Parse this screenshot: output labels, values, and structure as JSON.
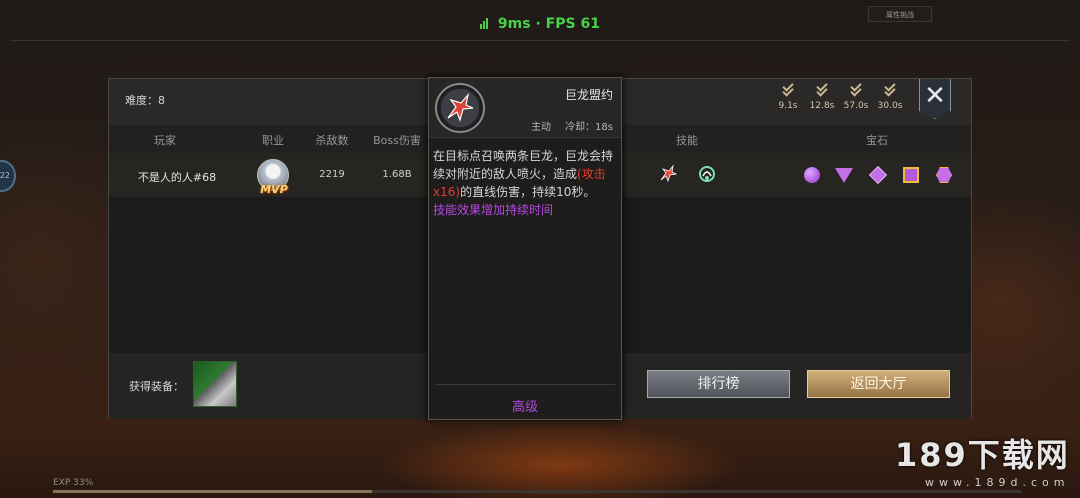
{
  "hud": {
    "ping": "9ms",
    "separator": "·",
    "fps": "FPS 61",
    "top_right_tab": "属性挑战",
    "side_badge": "22",
    "exp": "EXP 33%",
    "exp_progress": 0.33
  },
  "watermark": {
    "main": "189下载网",
    "url": "www.189d.com"
  },
  "panel": {
    "difficulty": "难度：8",
    "buffs": [
      {
        "icon": "rank-chevron-icon",
        "time": "9.1s"
      },
      {
        "icon": "rank-chevron-icon",
        "time": "12.8s"
      },
      {
        "icon": "rank-chevron-icon",
        "time": "57.0s"
      },
      {
        "icon": "rank-chevron-icon",
        "time": "30.0s"
      }
    ],
    "close_glyph": "✕",
    "columns": [
      "玩家",
      "职业",
      "杀敌数",
      "Boss伤害",
      "技能",
      "宝石"
    ],
    "rows": [
      {
        "player": "不是人的人#68",
        "mvp": "MVP",
        "kills": "2219",
        "boss_damage": "1.68B",
        "skills": [
          "dragon-skill-icon",
          "serpent-skill-icon"
        ],
        "gems": [
          "purple-circle-gem",
          "purple-triangle-gem",
          "purple-diamond-gem",
          "purple-square-gem",
          "purple-hexagon-gem"
        ]
      }
    ],
    "loot_label": "获得装备：",
    "buttons": {
      "rank": "排行榜",
      "lobby": "返回大厅"
    }
  },
  "tooltip": {
    "icon": "dragon-skill-icon",
    "name": "巨龙盟约",
    "type": "主动",
    "cooldown": "冷却：18s",
    "desc_before": "在目标点召唤两条巨龙，巨龙会持续对附近的敌人喷火，造成",
    "desc_red": "(攻击x16)",
    "desc_after": "的直线伤害，持续10秒。",
    "desc_extra": "技能效果增加持续时间",
    "level": "高级"
  },
  "colors": {
    "fps_green": "#49d14a",
    "damage_red": "#e63a2e",
    "upgrade_purple": "#b548e6",
    "lobby_gold": "#c6a26c"
  }
}
